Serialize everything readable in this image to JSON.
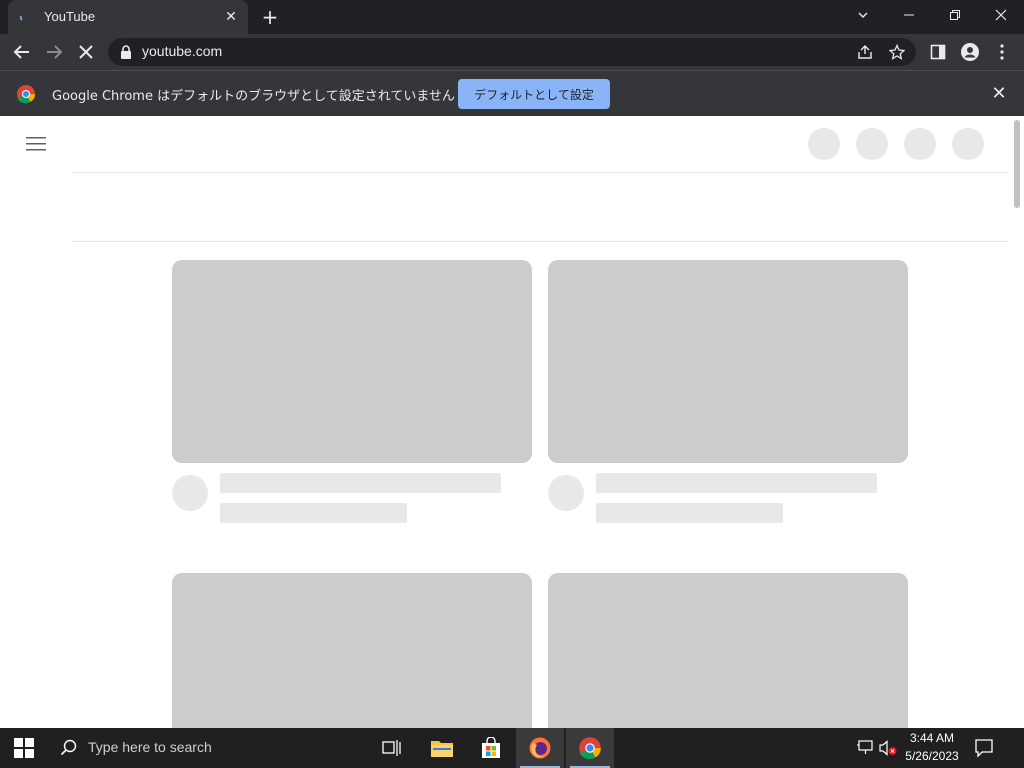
{
  "browser": {
    "tab": {
      "title": "YouTube",
      "close": "✕"
    },
    "new_tab": "+",
    "window_controls": {
      "list": "⌄",
      "minimize": "—",
      "restore": "❐",
      "close": "✕"
    },
    "toolbar": {
      "url": "youtube.com"
    }
  },
  "infobar": {
    "message": "Google Chrome はデフォルトのブラウザとして設定されていません",
    "button_label": "デフォルトとして設定",
    "close": "✕"
  },
  "taskbar": {
    "search_placeholder": "Type here to search",
    "time": "3:44 AM",
    "date": "5/26/2023"
  },
  "icons": {
    "tab_favicon": "youtube-loading-icon",
    "back": "arrow-left-icon",
    "forward": "arrow-right-icon",
    "stop": "close-icon",
    "share": "share-icon",
    "bookmark": "star-icon",
    "sidepanel": "side-panel-icon",
    "profile": "person-icon",
    "menu": "kebab-icon"
  },
  "colors": {
    "chrome_dark": "#202124",
    "chrome_toolbar": "#35363a",
    "accent": "#8ab4f8",
    "skeleton": "#cccccc",
    "skeleton_light": "#e8e8e8"
  }
}
